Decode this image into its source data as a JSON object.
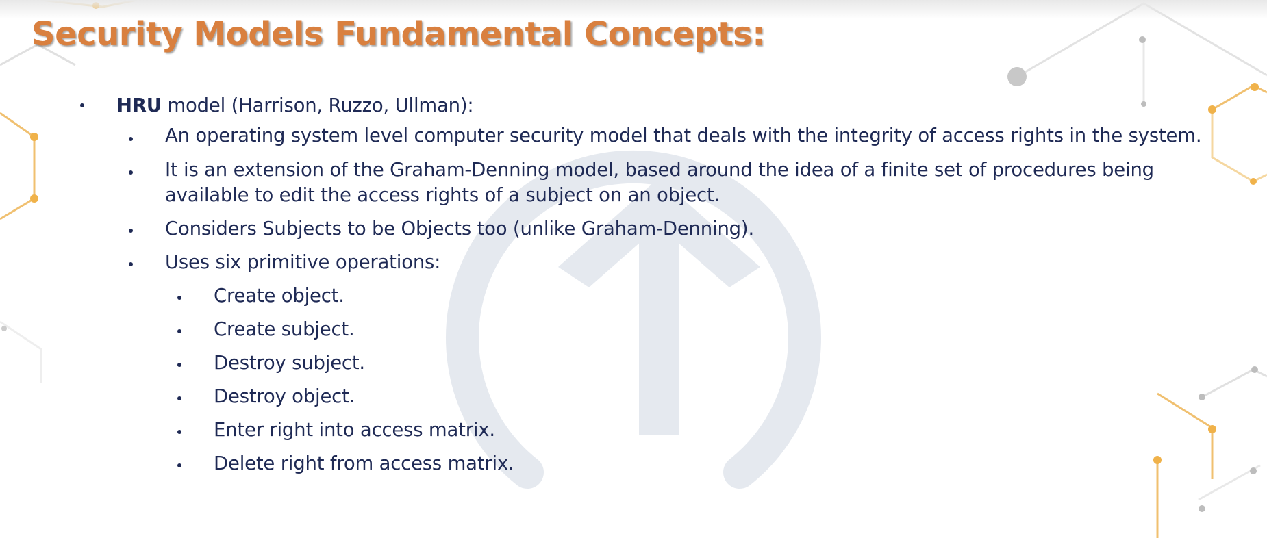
{
  "slide": {
    "title": "Security Models Fundamental Concepts:",
    "hru": {
      "name": "HRU",
      "desc": " model (Harrison, Ruzzo, Ullman):"
    },
    "points": [
      "An operating system level computer security model that deals with the integrity of access rights in the system.",
      "It is an extension of the Graham-Denning model, based around the idea of a finite set of procedures being",
      "available to edit the access rights of a subject on an object.",
      "Considers Subjects to be Objects too (unlike Graham-Denning).",
      "Uses six primitive operations:"
    ],
    "operations": [
      "Create object.",
      "Create subject.",
      "Destroy subject.",
      "Destroy object.",
      "Enter right into access matrix.",
      "Delete right from access matrix."
    ]
  },
  "colors": {
    "title": "#d9803f",
    "text": "#1f2a55",
    "hex_orange": "#f0b24a",
    "hex_gray": "#bdbdbd",
    "watermark": "#e4e8ee"
  },
  "decor": {
    "watermark_icon": "circle-up-arrow-icon",
    "pattern_icon": "hexagon-network-icon"
  }
}
